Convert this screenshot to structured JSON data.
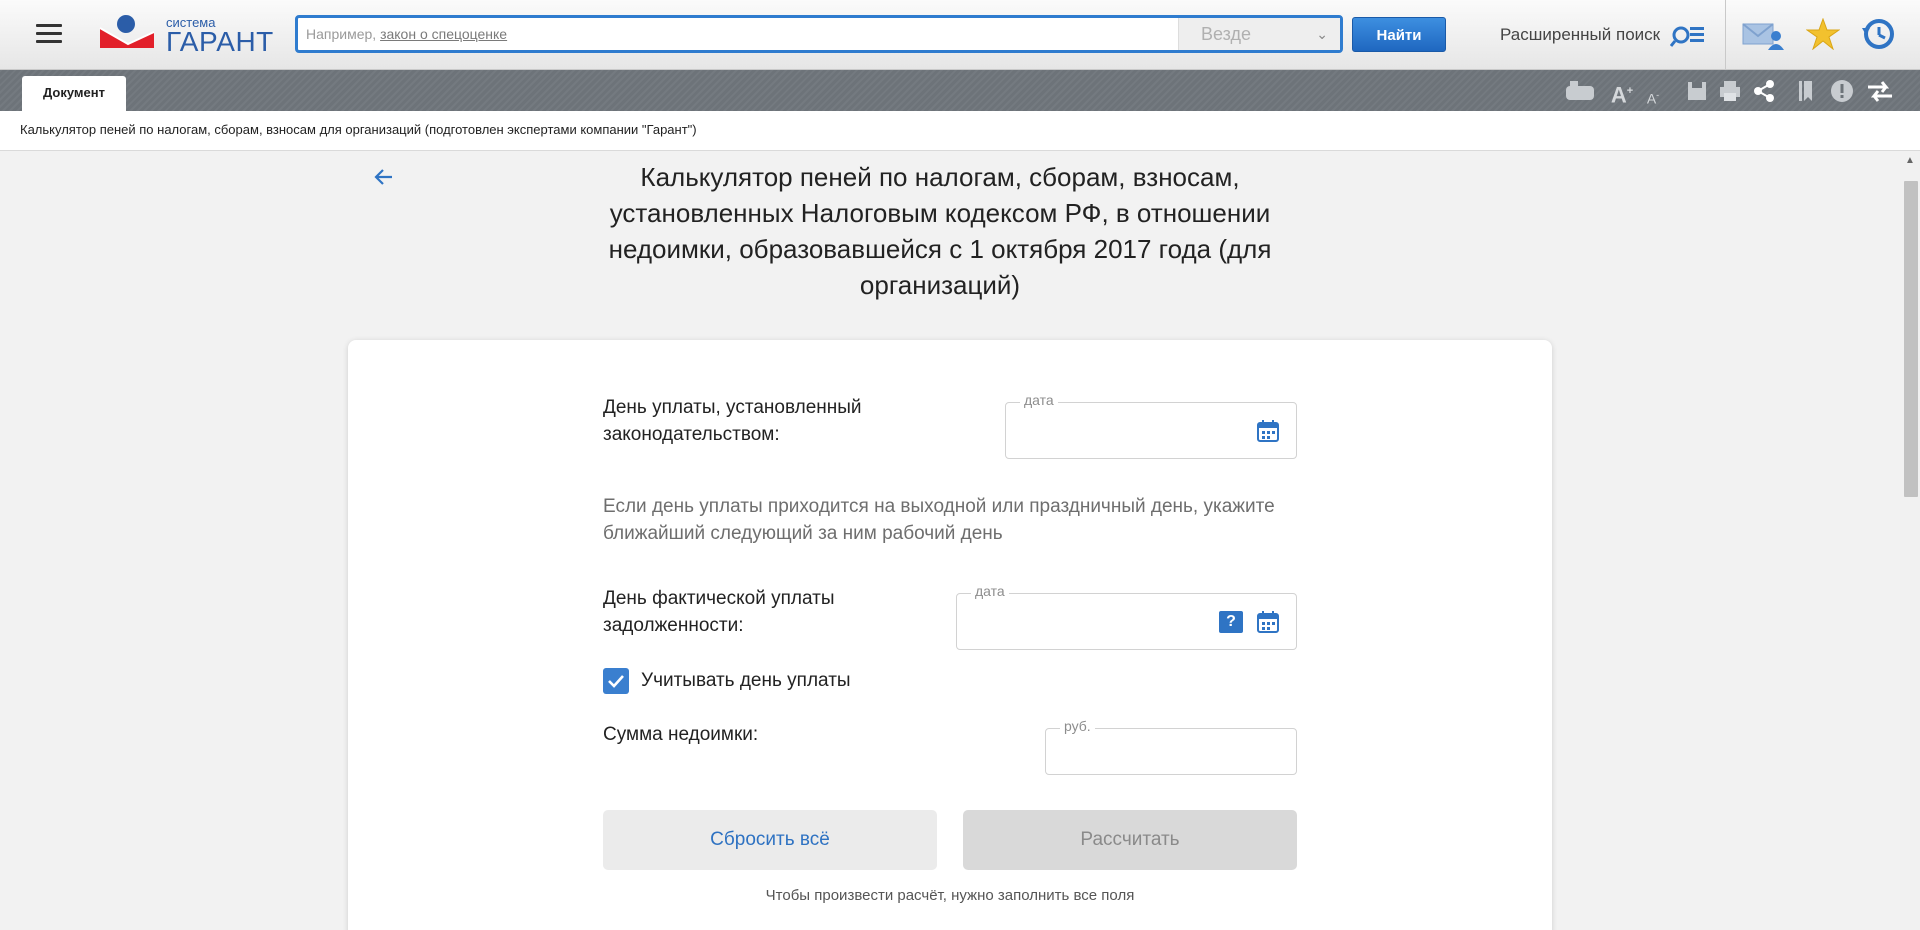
{
  "header": {
    "logo_small": "система",
    "logo_big": "ГАРАНТ",
    "search_prefix": "Например, ",
    "search_example": "закон о спецоценке",
    "scope": "Везде",
    "find_button": "Найти",
    "advanced_search": "Расширенный поиск"
  },
  "tabs": {
    "document": "Документ"
  },
  "doc_title_bar": "Калькулятор пеней по налогам, сборам, взносам для организаций (подготовлен экспертами компании \"Гарант\")",
  "calculator": {
    "title": "Калькулятор пеней по налогам, сборам, взносам, установленных Налоговым кодексом РФ, в отношении недоимки, образовавшейся с 1 октября 2017 года (для организаций)",
    "due_date_label": "День уплаты, установленный законодательством:",
    "due_date_placeholder": "дата",
    "due_date_hint": "Если день уплаты приходится на выходной или праздничный день, укажите ближайший следующий за ним рабочий день",
    "actual_date_label": "День фактической уплаты задолженности:",
    "actual_date_placeholder": "дата",
    "help_symbol": "?",
    "include_pay_day_label": "Учитывать день уплаты",
    "include_pay_day_checked": true,
    "arrears_label": "Сумма недоимки:",
    "arrears_placeholder": "руб.",
    "reset_button": "Сбросить всё",
    "calculate_button": "Рассчитать",
    "fill_all_note": "Чтобы произвести расчёт, нужно заполнить все поля"
  },
  "colors": {
    "accent": "#2f7ccf",
    "tabbar": "#6d7379",
    "checkbox": "#3a7fcf"
  }
}
